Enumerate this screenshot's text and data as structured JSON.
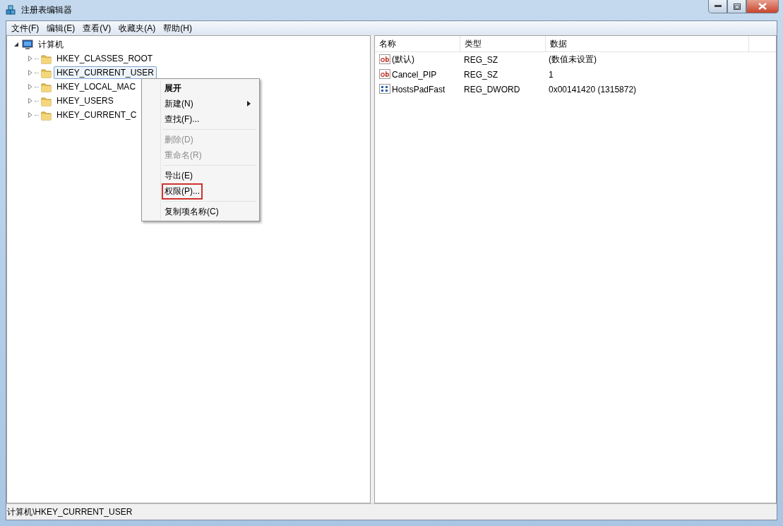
{
  "window": {
    "title": "注册表编辑器"
  },
  "menu_bar": [
    "文件(F)",
    "编辑(E)",
    "查看(V)",
    "收藏夹(A)",
    "帮助(H)"
  ],
  "tree": {
    "label": "计算机",
    "expanded": true,
    "children": [
      {
        "label": "HKEY_CLASSES_ROOT",
        "selected": false
      },
      {
        "label": "HKEY_CURRENT_USER",
        "selected": true
      },
      {
        "label": "HKEY_LOCAL_MAC",
        "selected": false
      },
      {
        "label": "HKEY_USERS",
        "selected": false
      },
      {
        "label": "HKEY_CURRENT_C",
        "selected": false
      }
    ]
  },
  "context_menu": [
    {
      "kind": "item",
      "label": "展开",
      "default": true,
      "disabled": false,
      "submenu": false,
      "outlined": false
    },
    {
      "kind": "item",
      "label": "新建(N)",
      "default": false,
      "disabled": false,
      "submenu": true,
      "outlined": false
    },
    {
      "kind": "item",
      "label": "查找(F)...",
      "default": false,
      "disabled": false,
      "submenu": false,
      "outlined": false
    },
    {
      "kind": "separator"
    },
    {
      "kind": "item",
      "label": "删除(D)",
      "default": false,
      "disabled": true,
      "submenu": false,
      "outlined": false
    },
    {
      "kind": "item",
      "label": "重命名(R)",
      "default": false,
      "disabled": true,
      "submenu": false,
      "outlined": false
    },
    {
      "kind": "separator"
    },
    {
      "kind": "item",
      "label": "导出(E)",
      "default": false,
      "disabled": false,
      "submenu": false,
      "outlined": false
    },
    {
      "kind": "item",
      "label": "权限(P)...",
      "default": false,
      "disabled": false,
      "submenu": false,
      "outlined": true
    },
    {
      "kind": "separator"
    },
    {
      "kind": "item",
      "label": "复制项名称(C)",
      "default": false,
      "disabled": false,
      "submenu": false,
      "outlined": false
    }
  ],
  "values_table": {
    "columns": [
      "名称",
      "类型",
      "数据"
    ],
    "rows": [
      {
        "kind": "string",
        "name": "(默认)",
        "type": "REG_SZ",
        "data": "(数值未设置)"
      },
      {
        "kind": "string",
        "name": "Cancel_PIP",
        "type": "REG_SZ",
        "data": "1"
      },
      {
        "kind": "binary",
        "name": "HostsPadFast",
        "type": "REG_DWORD",
        "data": "0x00141420 (1315872)"
      }
    ]
  },
  "status_bar": "计算机\\HKEY_CURRENT_USER"
}
